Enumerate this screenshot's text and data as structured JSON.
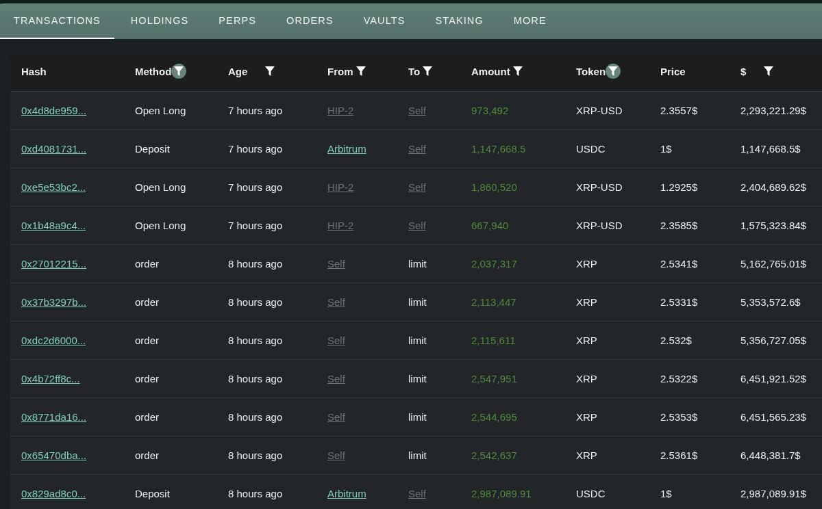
{
  "tabs": [
    {
      "label": "TRANSACTIONS",
      "selected": true
    },
    {
      "label": "HOLDINGS",
      "selected": false
    },
    {
      "label": "PERPS",
      "selected": false
    },
    {
      "label": "ORDERS",
      "selected": false
    },
    {
      "label": "VAULTS",
      "selected": false
    },
    {
      "label": "STAKING",
      "selected": false
    },
    {
      "label": "MORE",
      "selected": false
    }
  ],
  "table": {
    "columns": [
      {
        "label": "Hash"
      },
      {
        "label": "Method",
        "filter_active": true
      },
      {
        "label": "Age",
        "filter_active": false
      },
      {
        "label": "From",
        "filter_active": false
      },
      {
        "label": "To",
        "filter_active": false
      },
      {
        "label": "Amount",
        "filter_active": false
      },
      {
        "label": "Token",
        "filter_active": true
      },
      {
        "label": "Price"
      },
      {
        "label": "$",
        "filter_active": false
      }
    ],
    "rows": [
      {
        "hash": "0x4d8de959...",
        "method": "Open Long",
        "age": "7 hours ago",
        "from": {
          "kind": "link",
          "text": "HIP-2",
          "muted": true
        },
        "to": {
          "kind": "link",
          "text": "Self",
          "muted": true
        },
        "amount": "973,492",
        "token": "XRP-USD",
        "price": "2.3557$",
        "usd": "2,293,221.29$"
      },
      {
        "hash": "0xd4081731...",
        "method": "Deposit",
        "age": "7 hours ago",
        "from": {
          "kind": "link",
          "text": "Arbitrum",
          "muted": false
        },
        "to": {
          "kind": "link",
          "text": "Self",
          "muted": true
        },
        "amount": "1,147,668.5",
        "token": "USDC",
        "price": "1$",
        "usd": "1,147,668.5$"
      },
      {
        "hash": "0xe5e53bc2...",
        "method": "Open Long",
        "age": "7 hours ago",
        "from": {
          "kind": "link",
          "text": "HIP-2",
          "muted": true
        },
        "to": {
          "kind": "link",
          "text": "Self",
          "muted": true
        },
        "amount": "1,860,520",
        "token": "XRP-USD",
        "price": "1.2925$",
        "usd": "2,404,689.62$"
      },
      {
        "hash": "0x1b48a9c4...",
        "method": "Open Long",
        "age": "7 hours ago",
        "from": {
          "kind": "link",
          "text": "HIP-2",
          "muted": true
        },
        "to": {
          "kind": "link",
          "text": "Self",
          "muted": true
        },
        "amount": "667,940",
        "token": "XRP-USD",
        "price": "2.3585$",
        "usd": "1,575,323.84$"
      },
      {
        "hash": "0x27012215...",
        "method": "order",
        "age": "8 hours ago",
        "from": {
          "kind": "link",
          "text": "Self",
          "muted": true
        },
        "to": {
          "kind": "text",
          "text": "limit"
        },
        "amount": "2,037,317",
        "token": "XRP",
        "price": "2.5341$",
        "usd": "5,162,765.01$"
      },
      {
        "hash": "0x37b3297b...",
        "method": "order",
        "age": "8 hours ago",
        "from": {
          "kind": "link",
          "text": "Self",
          "muted": true
        },
        "to": {
          "kind": "text",
          "text": "limit"
        },
        "amount": "2,113,447",
        "token": "XRP",
        "price": "2.5331$",
        "usd": "5,353,572.6$"
      },
      {
        "hash": "0xdc2d6000...",
        "method": "order",
        "age": "8 hours ago",
        "from": {
          "kind": "link",
          "text": "Self",
          "muted": true
        },
        "to": {
          "kind": "text",
          "text": "limit"
        },
        "amount": "2,115,611",
        "token": "XRP",
        "price": "2.532$",
        "usd": "5,356,727.05$"
      },
      {
        "hash": "0x4b72ff8c...",
        "method": "order",
        "age": "8 hours ago",
        "from": {
          "kind": "link",
          "text": "Self",
          "muted": true
        },
        "to": {
          "kind": "text",
          "text": "limit"
        },
        "amount": "2,547,951",
        "token": "XRP",
        "price": "2.5322$",
        "usd": "6,451,921.52$"
      },
      {
        "hash": "0x8771da16...",
        "method": "order",
        "age": "8 hours ago",
        "from": {
          "kind": "link",
          "text": "Self",
          "muted": true
        },
        "to": {
          "kind": "text",
          "text": "limit"
        },
        "amount": "2,544,695",
        "token": "XRP",
        "price": "2.5353$",
        "usd": "6,451,565.23$"
      },
      {
        "hash": "0x65470dba...",
        "method": "order",
        "age": "8 hours ago",
        "from": {
          "kind": "link",
          "text": "Self",
          "muted": true
        },
        "to": {
          "kind": "text",
          "text": "limit"
        },
        "amount": "2,542,637",
        "token": "XRP",
        "price": "2.5361$",
        "usd": "6,448,381.7$"
      },
      {
        "hash": "0x829ad8c0...",
        "method": "Deposit",
        "age": "8 hours ago",
        "from": {
          "kind": "link",
          "text": "Arbitrum",
          "muted": false
        },
        "to": {
          "kind": "link",
          "text": "Self",
          "muted": true
        },
        "amount": "2,987,089.91",
        "token": "USDC",
        "price": "1$",
        "usd": "2,987,089.91$"
      }
    ]
  }
}
